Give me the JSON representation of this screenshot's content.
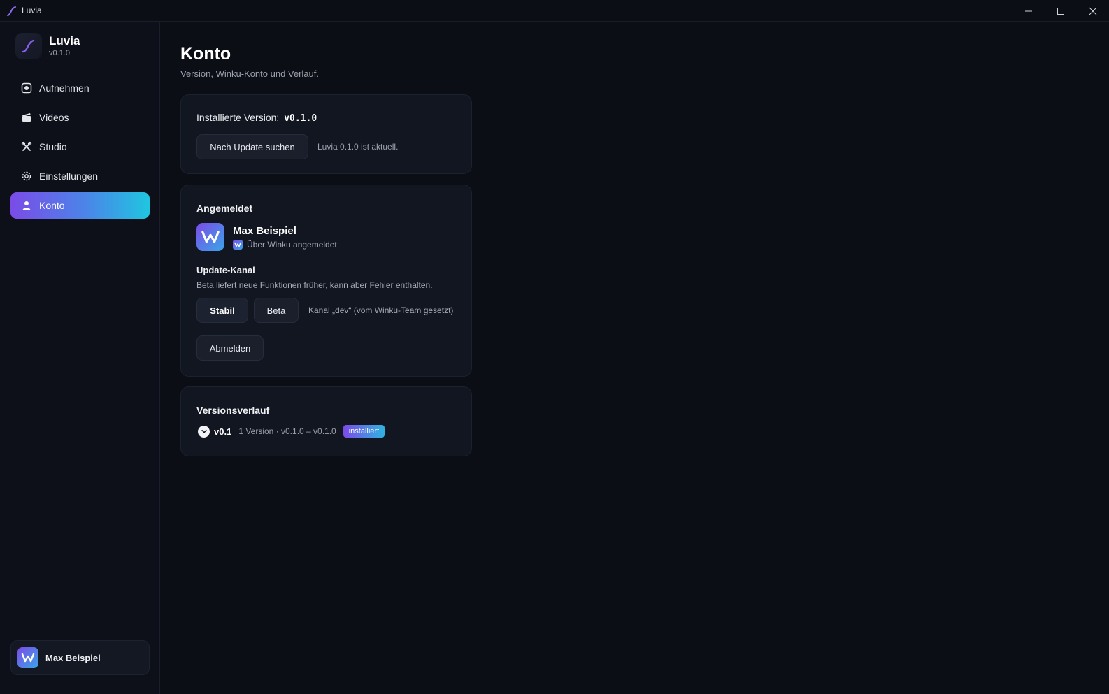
{
  "window": {
    "title": "Luvia",
    "controls": {
      "minimize": "minimize-icon",
      "maximize": "maximize-icon",
      "close": "close-icon"
    }
  },
  "sidebar": {
    "brand": {
      "name": "Luvia",
      "version": "v0.1.0"
    },
    "items": [
      {
        "label": "Aufnehmen",
        "icon": "record-icon",
        "active": false
      },
      {
        "label": "Videos",
        "icon": "clapperboard-icon",
        "active": false
      },
      {
        "label": "Studio",
        "icon": "tools-icon",
        "active": false
      },
      {
        "label": "Einstellungen",
        "icon": "gear-icon",
        "active": false
      },
      {
        "label": "Konto",
        "icon": "user-icon",
        "active": true
      }
    ],
    "user": {
      "name": "Max Beispiel",
      "avatar_letter": "W"
    }
  },
  "main": {
    "title": "Konto",
    "subtitle": "Version, Winku-Konto und Verlauf.",
    "version_card": {
      "label": "Installierte Version:",
      "version": "v0.1.0",
      "check_button": "Nach Update suchen",
      "status": "Luvia 0.1.0 ist aktuell."
    },
    "account_card": {
      "heading": "Angemeldet",
      "name": "Max Beispiel",
      "provider_text": "Über Winku angemeldet",
      "channel_heading": "Update-Kanal",
      "channel_desc": "Beta liefert neue Funktionen früher, kann aber Fehler enthalten.",
      "stable_button": "Stabil",
      "beta_button": "Beta",
      "channel_status": "Kanal „dev“ (vom Winku-Team gesetzt)",
      "logout_button": "Abmelden"
    },
    "history_card": {
      "heading": "Versionsverlauf",
      "version": "v0.1",
      "meta": "1 Version · v0.1.0 – v0.1.0",
      "badge": "installiert"
    }
  },
  "colors": {
    "accent_start": "#7b4be8",
    "accent_end": "#1fc6e0",
    "background": "#0b0e15",
    "card": "#121620"
  }
}
